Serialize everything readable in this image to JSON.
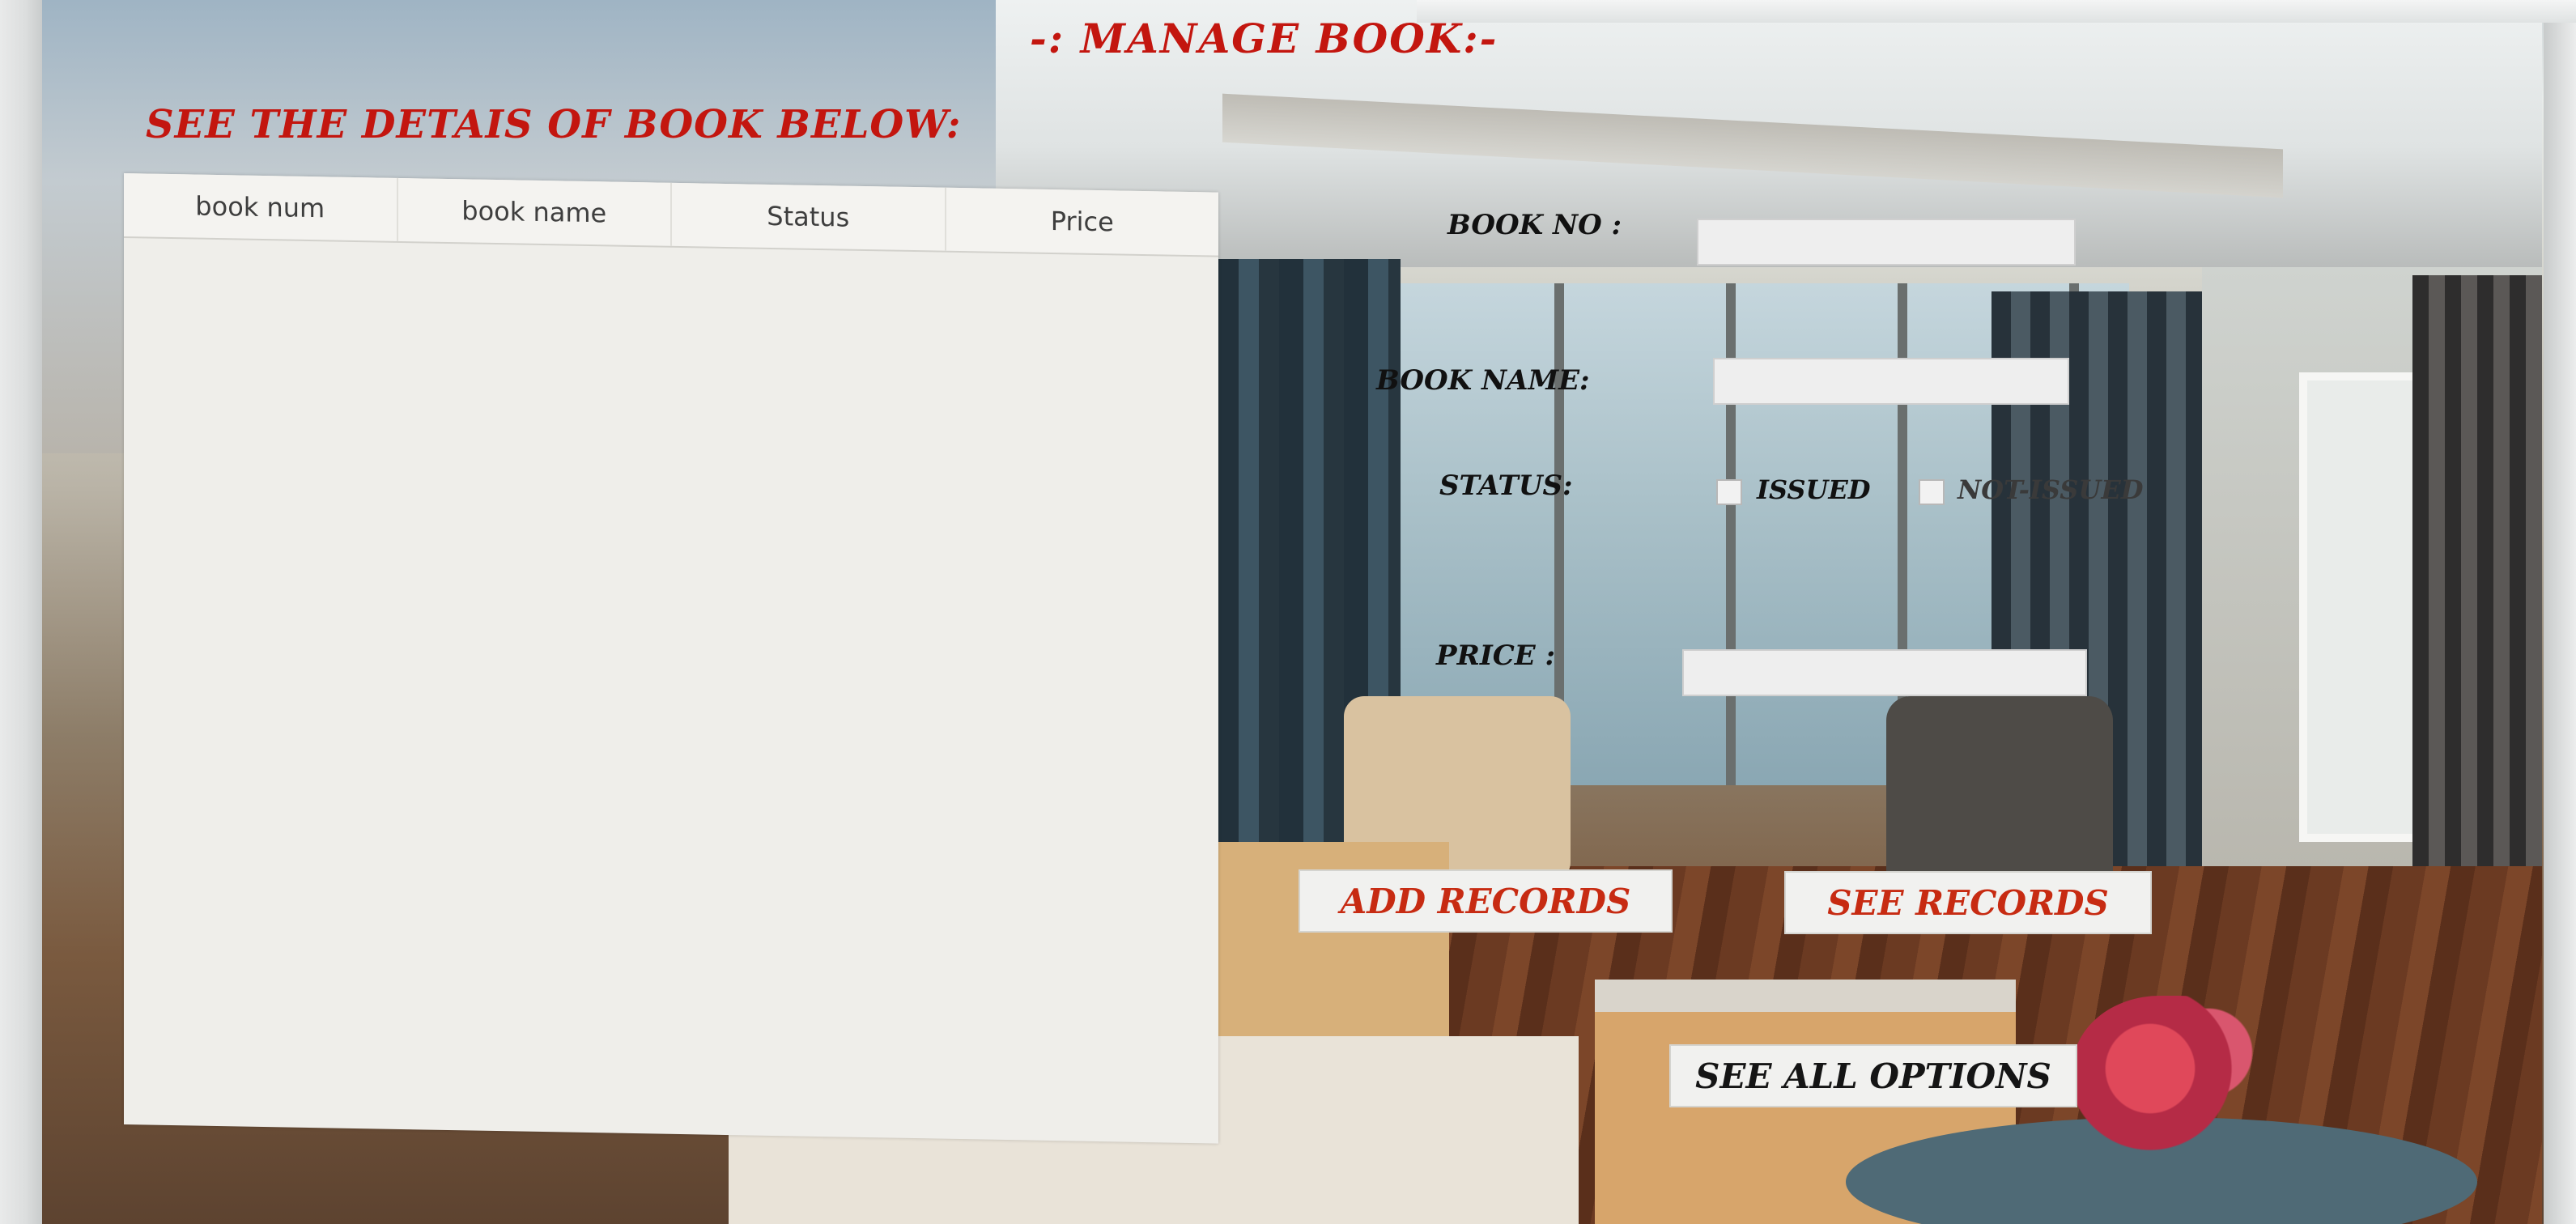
{
  "window": {
    "title": "-: MANAGE  BOOK:-",
    "subtitle": "SEE THE DETAIS OF BOOK BELOW:"
  },
  "table": {
    "columns": [
      "book num",
      "book name",
      "Status",
      "Price"
    ],
    "rows": []
  },
  "form": {
    "book_no_label": "BOOK NO :",
    "book_no_value": "",
    "book_name_label": "BOOK NAME:",
    "book_name_value": "",
    "status_label": "STATUS:",
    "status_options": {
      "issued": "ISSUED",
      "not_issued": "NOT-ISSUED"
    },
    "price_label": "PRICE :",
    "price_value": ""
  },
  "buttons": {
    "add_records": "ADD RECORDS",
    "see_records": "SEE RECORDS",
    "see_all_options": "SEE ALL OPTIONS"
  },
  "colors": {
    "title_red": "#c3160f",
    "button_red": "#c72b12",
    "panel": "#efeeea"
  }
}
